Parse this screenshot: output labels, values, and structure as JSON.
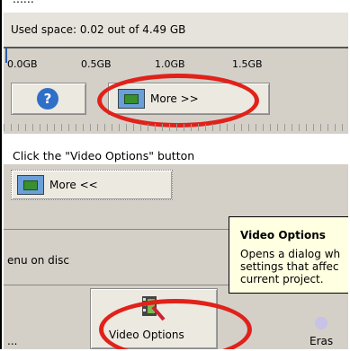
{
  "top_caption": "......",
  "used_space": "Used space: 0.02 out of 4.49 GB",
  "ruler": [
    "0.0GB",
    "0.5GB",
    "1.0GB",
    "1.5GB"
  ],
  "help_icon_glyph": "?",
  "more_button_label": "More >>",
  "instruction": "Click the \"Video Options\" button",
  "less_button_label": "More <<",
  "menu_text": "enu on disc",
  "tooltip": {
    "title": "Video Options",
    "line1": "Opens a dialog wh",
    "line2": "settings that affec",
    "line3": "current project."
  },
  "left_dots": "...",
  "video_options_label": "Video Options",
  "erase_label": "Eras",
  "colors": {
    "panel": "#d4d0c8",
    "tooltip": "#ffffe1",
    "highlight": "#e0221a",
    "accent": "#6a9fd8"
  }
}
